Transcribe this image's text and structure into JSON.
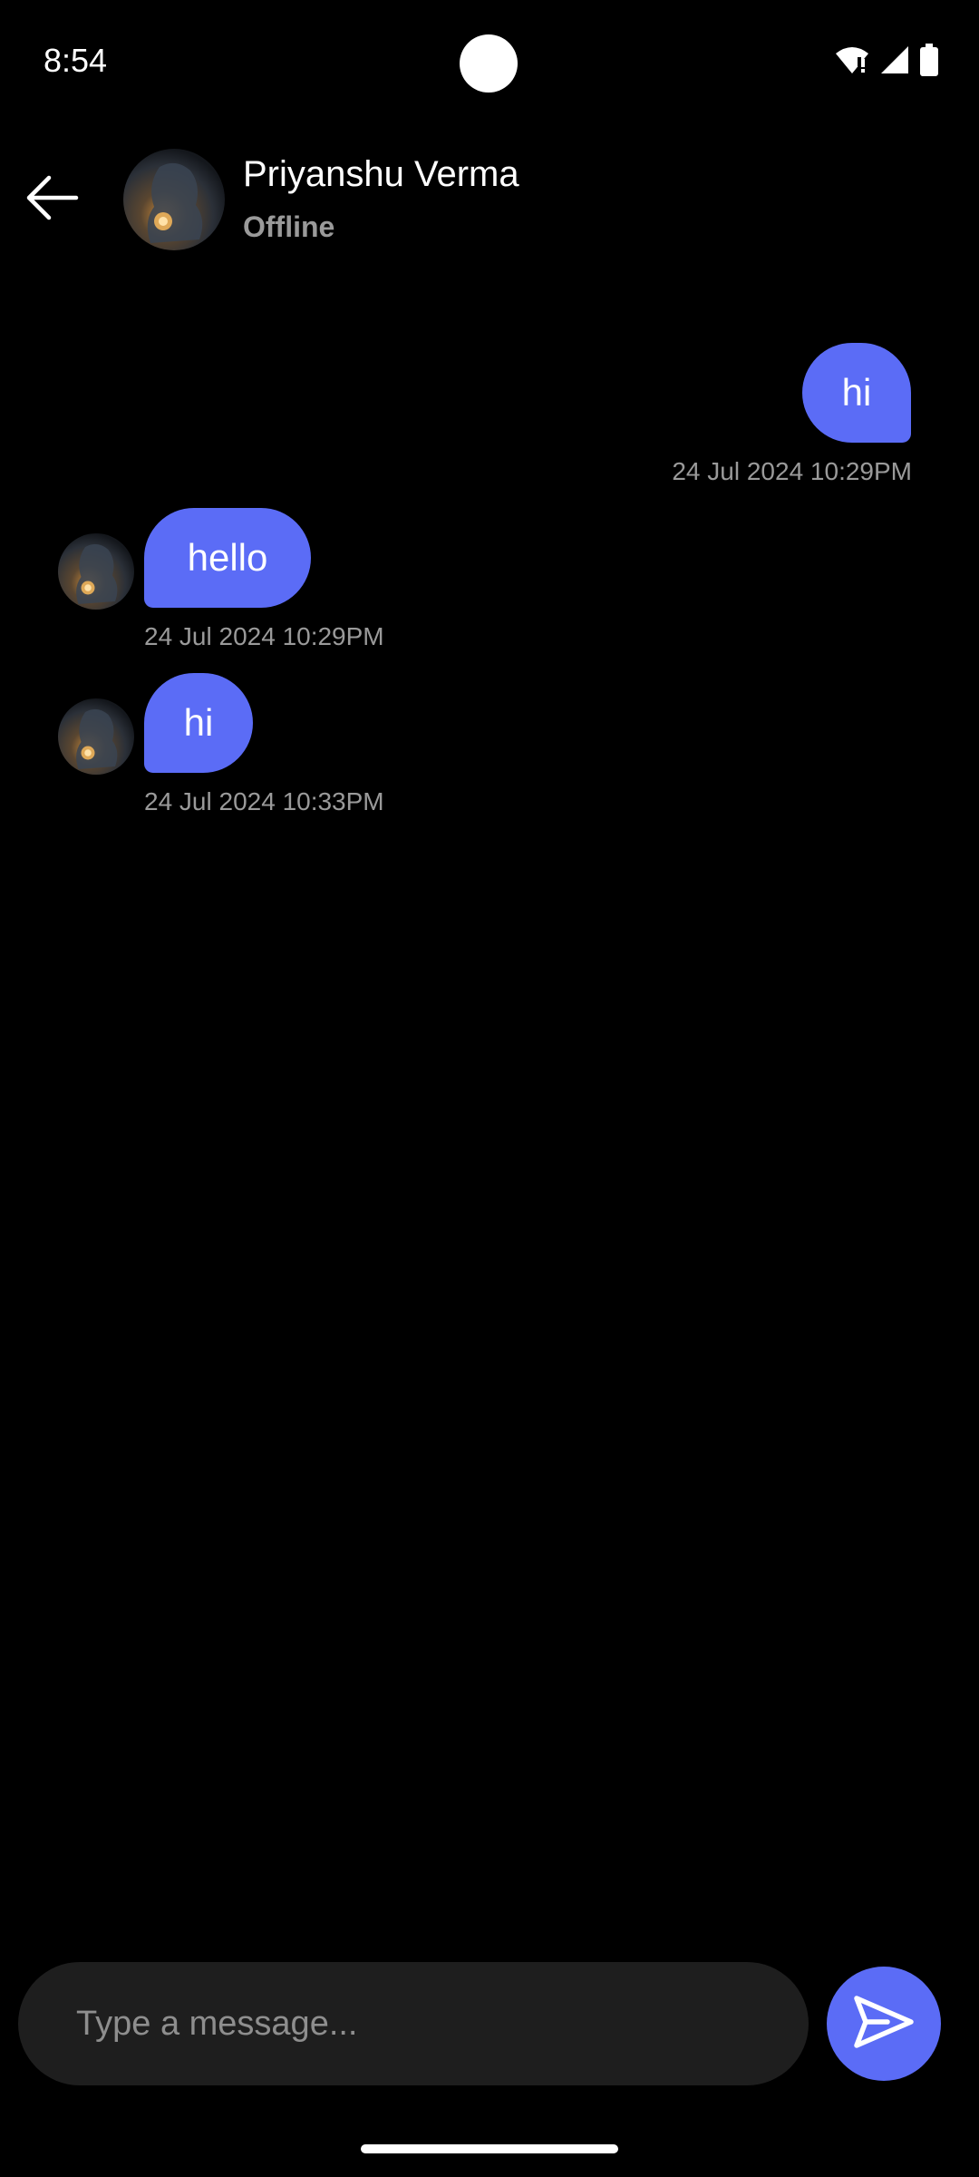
{
  "status_bar": {
    "time": "8:54",
    "icons": [
      "wifi-alert-icon",
      "cellular-signal-icon",
      "battery-icon"
    ]
  },
  "header": {
    "back_icon": "arrow-left-icon",
    "contact_name": "Priyanshu Verma",
    "contact_status": "Offline"
  },
  "messages": [
    {
      "direction": "sent",
      "text": "hi",
      "timestamp": "24 Jul 2024 10:29PM"
    },
    {
      "direction": "received",
      "text": "hello",
      "timestamp": "24 Jul 2024 10:29PM"
    },
    {
      "direction": "received",
      "text": "hi",
      "timestamp": "24 Jul 2024 10:33PM"
    }
  ],
  "composer": {
    "placeholder": "Type a message...",
    "value": "",
    "send_icon": "send-icon"
  },
  "colors": {
    "accent": "#5b6cf6",
    "background": "#000000",
    "input_background": "#1e1e1e",
    "muted_text": "#9a9a9a"
  }
}
